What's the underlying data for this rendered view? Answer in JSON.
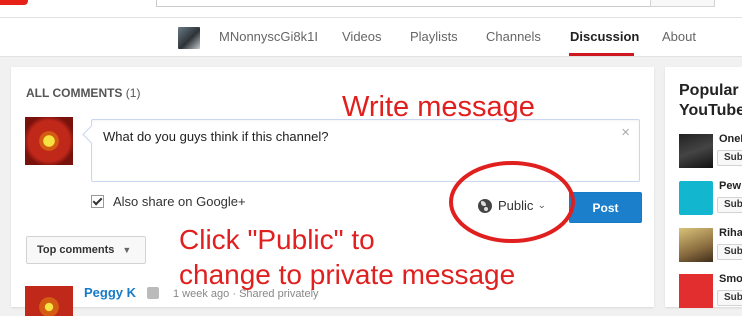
{
  "channel": {
    "name": "MNonnyscGi8k1I",
    "tabs": [
      {
        "label": "Videos"
      },
      {
        "label": "Playlists"
      },
      {
        "label": "Channels"
      },
      {
        "label": "Discussion",
        "active": true
      },
      {
        "label": "About"
      }
    ]
  },
  "discussion": {
    "heading": "ALL COMMENTS",
    "count": "(1)",
    "compose": {
      "text": "What do you guys think if this channel?",
      "close_icon": "×",
      "share_label": "Also share on Google+",
      "share_checked": true,
      "visibility_label": "Public",
      "post_label": "Post"
    },
    "sort_label": "Top comments",
    "comments": [
      {
        "author": "Peggy K",
        "time": "1 week ago",
        "visibility": "Shared privately"
      }
    ]
  },
  "sidebar": {
    "title_line1": "Popular",
    "title_line2": "YouTube",
    "channels": [
      {
        "name": "OneR",
        "subscribe": "Sub"
      },
      {
        "name": "Pew",
        "subscribe": "Sub"
      },
      {
        "name": "Riha",
        "subscribe": "Sub"
      },
      {
        "name": "Smo",
        "subscribe": "Sub"
      }
    ]
  },
  "annotations": {
    "write": "Write message",
    "click_line1": "Click \"Public\" to",
    "click_line2": "change to private message",
    "color": "#e0201f"
  },
  "colors": {
    "accent": "#cc181e",
    "link": "#167ac6",
    "post_button": "#1b7fcc"
  }
}
